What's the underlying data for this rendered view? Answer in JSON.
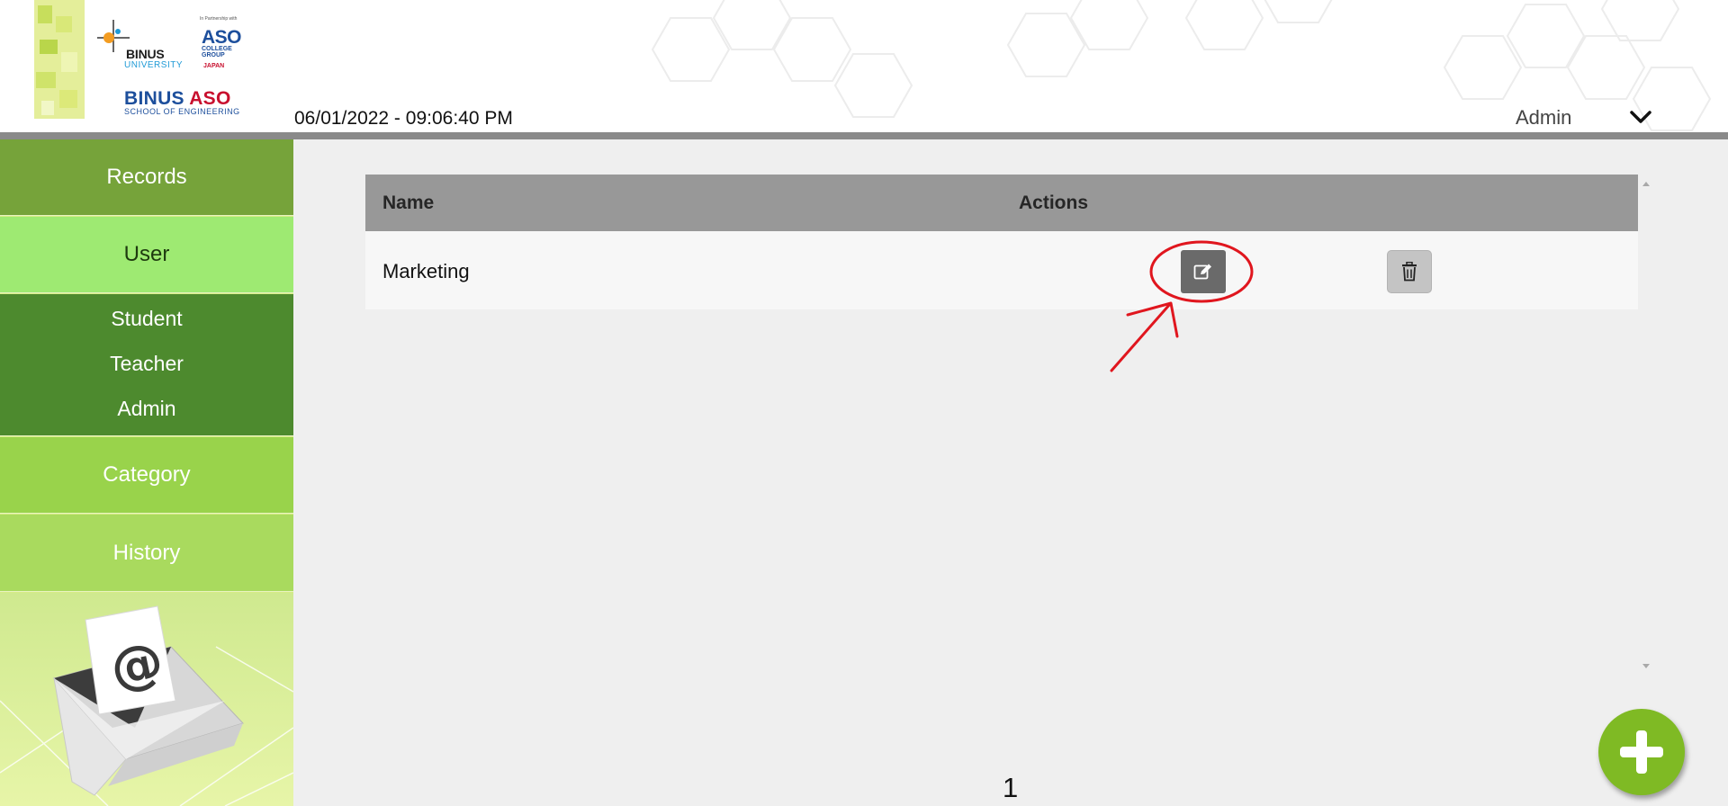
{
  "header": {
    "datetime": "06/01/2022 - 09:06:40 PM",
    "user_name": "Admin",
    "user_menu_icon": "chevron-down-icon",
    "logos": {
      "binus": "BINUS",
      "binus_sub": "UNIVERSITY",
      "aso_partnership": "In Partnership with",
      "aso": "ASO",
      "aso_college": "COLLEGE",
      "aso_group": "GROUP",
      "aso_japan": "JAPAN",
      "school_binus": "BINUS",
      "school_aso": "ASO",
      "school_sub": "SCHOOL OF ENGINEERING"
    }
  },
  "sidebar": {
    "records": "Records",
    "user": "User",
    "user_submenu": [
      "Student",
      "Teacher",
      "Admin"
    ],
    "category": "Category",
    "history": "History",
    "decoration_icon": "envelope-at-icon"
  },
  "table": {
    "headers": {
      "name": "Name",
      "actions": "Actions"
    },
    "rows": [
      {
        "name": "Marketing",
        "edit_icon": "edit-icon",
        "delete_icon": "trash-icon"
      }
    ]
  },
  "pagination": {
    "current_page": "1"
  },
  "add_button_icon": "plus-icon",
  "colors": {
    "sidebar_records": "#76a33a",
    "sidebar_user_active": "#9eea72",
    "sidebar_submenu": "#4d8a2e",
    "sidebar_category": "#99d34b",
    "sidebar_history": "#a9da5e",
    "table_header": "#989898",
    "edit_button": "#6a6a6a",
    "delete_button": "#c4c4c4",
    "fab": "#7fba24",
    "annotation": "#e0161e"
  }
}
